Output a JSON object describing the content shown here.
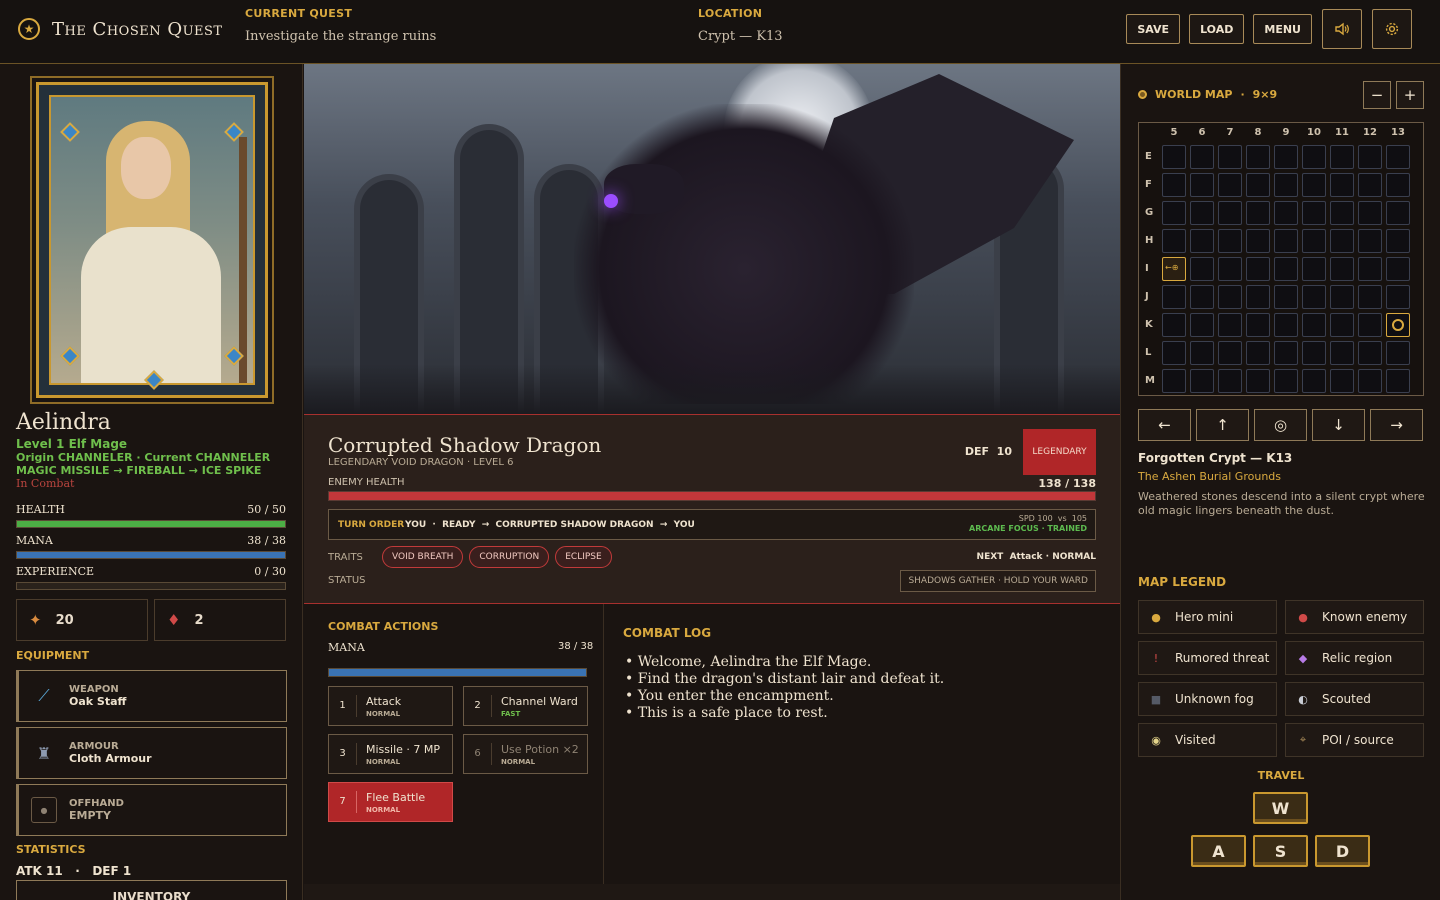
{
  "topbar": {
    "title": "The Chosen Quest",
    "emblem_icon": "star-emblem-icon",
    "quest_label": "CURRENT QUEST",
    "quest_value": "Investigate the strange ruins",
    "location_label": "LOCATION",
    "location_value": "Crypt — K13",
    "save": "SAVE",
    "load": "LOAD",
    "menu": "MENU",
    "sound_icon": "speaker-icon",
    "settings_icon": "gear-icon"
  },
  "hero": {
    "name": "Aelindra",
    "level": "Level 1 Elf Mage",
    "origin": "Origin CHANNELER · Current CHANNELER",
    "spells": "MAGIC MISSILE → FIREBALL → ICE SPIKE",
    "state": "In Combat",
    "health_label": "HEALTH",
    "health_text": "50 / 50",
    "health_fraction": 1.0,
    "mana_label": "MANA",
    "mana_text": "38 / 38",
    "mana_fraction": 1.0,
    "xp_label": "EXPERIENCE",
    "xp_text": "0 / 30",
    "xp_fraction": 0.0,
    "gold": "20",
    "potions": "2",
    "equipment_label": "EQUIPMENT",
    "equipment": [
      {
        "slot": "WEAPON",
        "item": "Oak Staff",
        "icon": "staff-icon"
      },
      {
        "slot": "ARMOUR",
        "item": "Cloth Armour",
        "icon": "armour-icon"
      },
      {
        "slot": "OFFHAND",
        "item": "EMPTY",
        "icon": "empty-slot-icon"
      }
    ],
    "statistics_label": "STATISTICS",
    "stats_line": "ATK 11   ·   DEF 1",
    "inventory": "INVENTORY"
  },
  "enemy": {
    "name": "Corrupted Shadow Dragon",
    "subtitle": "LEGENDARY VOID DRAGON · LEVEL 6",
    "def": "DEF  10",
    "rank": "LEGENDARY",
    "health_label": "ENEMY HEALTH",
    "health_text": "138 / 138",
    "health_fraction": 1.0,
    "turn_label": "TURN ORDER",
    "turn_sequence": "YOU  ·  READY  →  CORRUPTED SHADOW DRAGON  →  YOU",
    "speed": "SPD 100  vs  105",
    "focus": "ARCANE FOCUS · TRAINED",
    "traits_label": "TRAITS",
    "traits": [
      "VOID BREATH",
      "CORRUPTION",
      "ECLIPSE"
    ],
    "next": "NEXT  Attack · NORMAL",
    "status_label": "STATUS",
    "status": "SHADOWS GATHER · HOLD YOUR WARD"
  },
  "actions": {
    "title": "COMBAT ACTIONS",
    "mana_label": "MANA",
    "mana_text": "38 / 38",
    "mana_fraction": 1.0,
    "items": [
      {
        "key": "1",
        "name": "Attack",
        "tag": "NORMAL"
      },
      {
        "key": "2",
        "name": "Channel Ward",
        "tag": "FAST"
      },
      {
        "key": "3",
        "name": "Missile · 7 MP",
        "tag": "NORMAL"
      },
      {
        "key": "6",
        "name": "Use Potion ×2",
        "tag": "NORMAL"
      },
      {
        "key": "7",
        "name": "Flee Battle",
        "tag": "NORMAL"
      }
    ]
  },
  "log": {
    "title": "COMBAT LOG",
    "entries": [
      "Welcome, Aelindra the Elf Mage.",
      "Find the dragon's distant lair and defeat it.",
      "You enter the encampment.",
      "This is a safe place to rest."
    ]
  },
  "map": {
    "title": "WORLD MAP",
    "size": "9×9",
    "zoom_out": "−",
    "zoom_in": "+",
    "columns": [
      "5",
      "6",
      "7",
      "8",
      "9",
      "10",
      "11",
      "12",
      "13"
    ],
    "rows": [
      "E",
      "F",
      "G",
      "H",
      "I",
      "J",
      "K",
      "L",
      "M"
    ],
    "visited_cell": "I5",
    "enemy_cell": "K13",
    "directions": [
      "←",
      "↑",
      "◎",
      "↓",
      "→"
    ],
    "location_title": "Forgotten Crypt — K13",
    "location_region": "The Ashen Burial Grounds",
    "location_desc": "Weathered stones descend into a silent crypt where old magic lingers beneath the dust.",
    "legend_title": "MAP LEGEND",
    "legend": [
      {
        "label": "Hero mini",
        "icon": "hero-dot-icon",
        "glyph": "●",
        "color": "#d9a93f"
      },
      {
        "label": "Known enemy",
        "icon": "enemy-dot-icon",
        "glyph": "●",
        "color": "#d04a48"
      },
      {
        "label": "Rumored threat",
        "icon": "exclamation-icon",
        "glyph": "!",
        "color": "#d04a48"
      },
      {
        "label": "Relic region",
        "icon": "diamond-icon",
        "glyph": "◆",
        "color": "#b77be6"
      },
      {
        "label": "Unknown fog",
        "icon": "fog-square-icon",
        "glyph": "■",
        "color": "#555a66"
      },
      {
        "label": "Scouted",
        "icon": "half-circle-icon",
        "glyph": "◐",
        "color": "#c9ccd4"
      },
      {
        "label": "Visited",
        "icon": "visited-ring-icon",
        "glyph": "◉",
        "color": "#e3d38a"
      },
      {
        "label": "POI / source",
        "icon": "crosshair-icon",
        "glyph": "⌖",
        "color": "#a88a58"
      }
    ],
    "travel_title": "TRAVEL",
    "keys": [
      "W",
      "A",
      "S",
      "D"
    ]
  }
}
